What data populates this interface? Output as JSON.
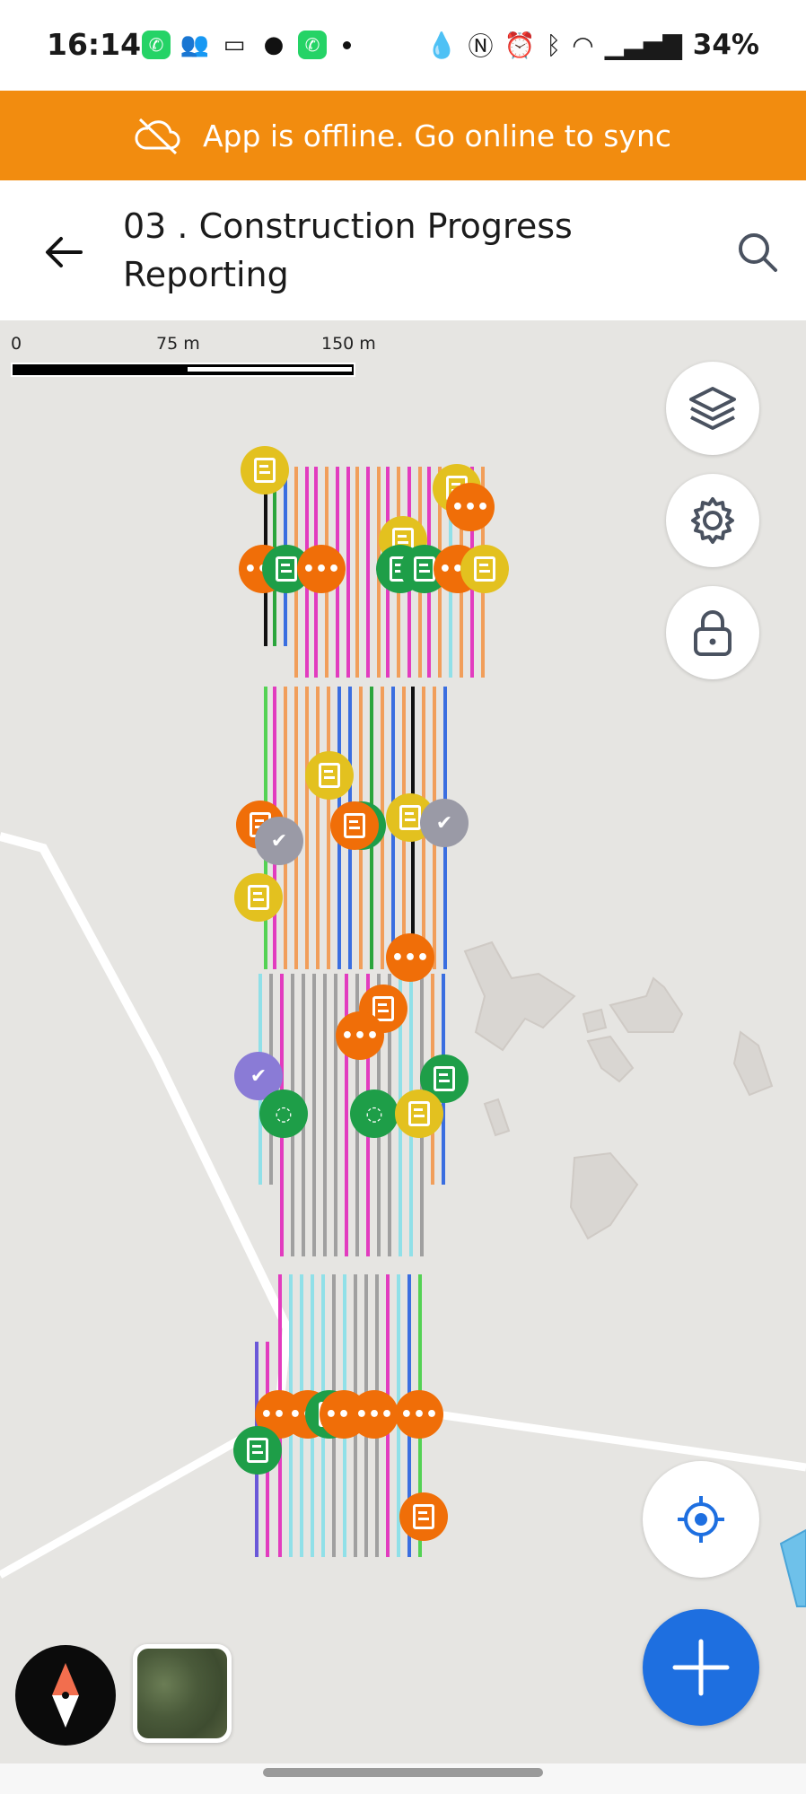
{
  "status_bar": {
    "time": "16:14",
    "battery": "34%",
    "left_icons": [
      "whatsapp-icon",
      "group-icon",
      "message-icon",
      "chat-icon",
      "whatsapp-icon"
    ],
    "right_icons": [
      "drop-icon",
      "nfc-icon",
      "alarm-icon",
      "bluetooth-icon",
      "wifi-icon",
      "signal-icon"
    ]
  },
  "banner": {
    "text": "App is offline. Go online to sync",
    "icon": "cloud-off-icon",
    "color": "#F28C0F"
  },
  "appbar": {
    "title": "03 . Construction Progress Reporting",
    "back_icon": "arrow-left-icon",
    "search_icon": "search-icon"
  },
  "map": {
    "scale": {
      "labels": [
        "0",
        "75 m",
        "150 m"
      ]
    },
    "controls": {
      "layers_icon": "layers-icon",
      "settings_icon": "gear-icon",
      "lock_icon": "lock-icon",
      "locate_icon": "crosshair-icon",
      "add_icon": "plus-icon",
      "compass_icon": "compass-icon",
      "basemap": "satellite-basemap-thumbnail"
    },
    "colors": {
      "map_background": "#E6E5E2",
      "add_button": "#1E6FE0",
      "marker_yellow": "#E3C11F",
      "marker_green": "#1E9E48",
      "marker_orange": "#F06E08",
      "marker_gray": "#9A9AA6",
      "marker_purple": "#8A7BD6"
    }
  }
}
